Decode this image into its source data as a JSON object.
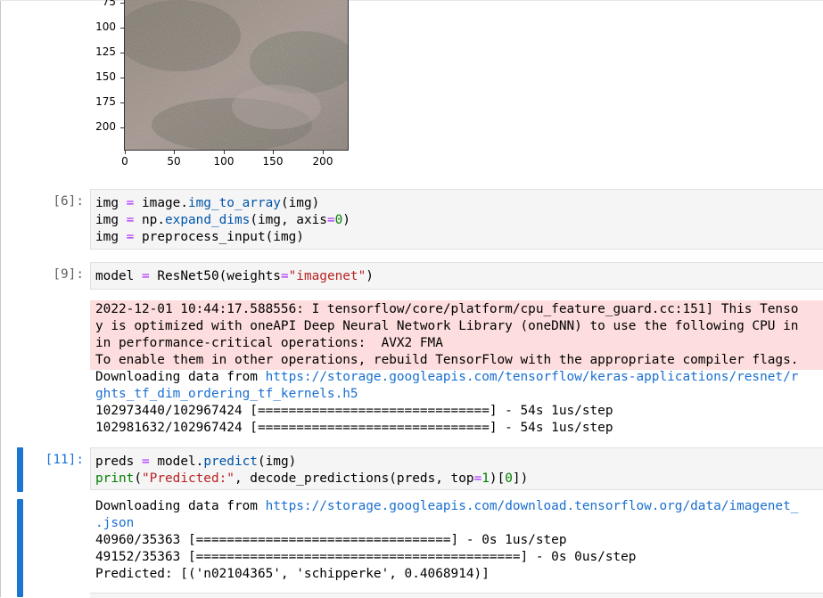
{
  "plot": {
    "yticks": [
      "75",
      "100",
      "125",
      "150",
      "175",
      "200"
    ],
    "xticks": [
      "0",
      "50",
      "100",
      "150",
      "200"
    ]
  },
  "cells": {
    "c6": {
      "prompt": "[6]:",
      "lines": [
        [
          "img",
          " = ",
          "image.",
          "img_to_array",
          "(img)"
        ],
        [
          "img",
          " = ",
          "np.",
          "expand_dims",
          "(img, axis",
          "=",
          "0",
          ")"
        ],
        [
          "img",
          " = ",
          "preprocess_input(img)"
        ]
      ]
    },
    "c9": {
      "prompt": "[9]:",
      "line": {
        "a": "model",
        "b": " = ",
        "c": "ResNet50(weights",
        "d": "=",
        "e": "\"imagenet\"",
        "f": ")"
      },
      "stderr": [
        "2022-12-01 10:44:17.588556: I tensorflow/core/platform/cpu_feature_guard.cc:151] This Tenso",
        "y is optimized with oneAPI Deep Neural Network Library (oneDNN) to use the following CPU in",
        "in performance-critical operations:  AVX2 FMA",
        "To enable them in other operations, rebuild TensorFlow with the appropriate compiler flags."
      ],
      "stdout": {
        "dl_prefix": "Downloading data from ",
        "dl_url1": "https://storage.googleapis.com/tensorflow/keras-applications/resnet/r",
        "dl_url2": "ghts_tf_dim_ordering_tf_kernels.h5",
        "p1": "102973440/102967424 [==============================] - 54s 1us/step",
        "p2": "102981632/102967424 [==============================] - 54s 1us/step"
      }
    },
    "c11": {
      "prompt": "[11]:",
      "l1": {
        "a": "preds",
        "b": " = ",
        "c": "model.",
        "d": "predict",
        "e": "(img)"
      },
      "l2": {
        "a": "print",
        "b": "(",
        "c": "\"Predicted:\"",
        "d": ", decode_predictions(preds, top",
        "e": "=",
        "f": "1",
        "g": ")[",
        "h": "0",
        "i": "])"
      },
      "stdout": {
        "dl_prefix": "Downloading data from ",
        "dl_url1": "https://storage.googleapis.com/download.tensorflow.org/data/imagenet_",
        "dl_url2": ".json",
        "p1": "40960/35363 [=================================] - 0s 1us/step",
        "p2": "49152/35363 [==========================================] - 0s 0us/step",
        "result": "Predicted: [('n02104365', 'schipperke', 0.4068914)]"
      }
    }
  },
  "colors": {
    "accent": "#1976d2",
    "stderr_bg": "#fddddd",
    "input_bg": "#f5f5f5"
  }
}
